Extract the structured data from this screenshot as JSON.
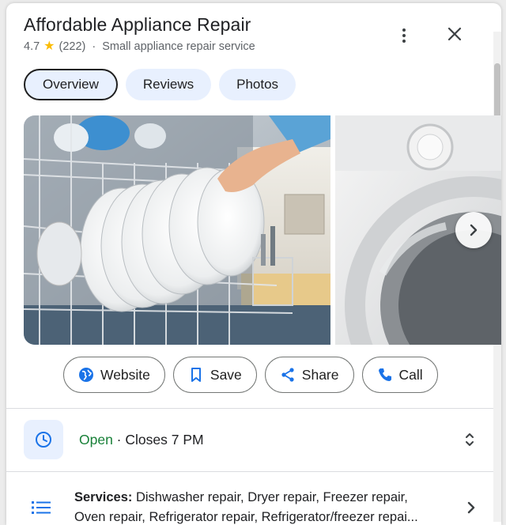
{
  "business": {
    "name": "Affordable Appliance Repair",
    "rating": "4.7",
    "review_count": "(222)",
    "separator": "·",
    "category": "Small appliance repair service"
  },
  "tabs": [
    {
      "label": "Overview",
      "active": true
    },
    {
      "label": "Reviews",
      "active": false
    },
    {
      "label": "Photos",
      "active": false
    }
  ],
  "actions": {
    "website": "Website",
    "save": "Save",
    "share": "Share",
    "call": "Call"
  },
  "hours": {
    "status": "Open",
    "separator": " · ",
    "closes": "Closes 7 PM"
  },
  "services": {
    "label": "Services:",
    "line1": " Dishwasher repair, Dryer repair, Freezer repair,",
    "line2": "Oven repair, Refrigerator repair, Refrigerator/freezer repai..."
  },
  "icons": {
    "more": "more-vert-icon",
    "close": "close-icon",
    "next": "chevron-right-icon",
    "website": "globe-icon",
    "save": "bookmark-icon",
    "share": "share-icon",
    "call": "phone-icon",
    "hours": "clock-icon",
    "expand": "unfold-icon",
    "services": "list-icon"
  },
  "colors": {
    "accent": "#1a73e8",
    "open": "#188038",
    "tab_bg": "#e8f0fe",
    "star": "#fbbc04"
  }
}
